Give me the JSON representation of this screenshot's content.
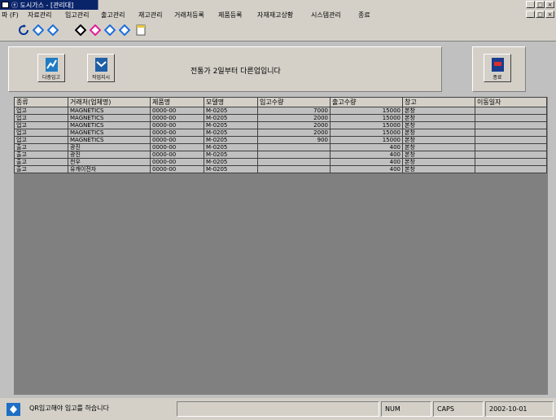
{
  "titlebar": {
    "title": "ⓔ 도시가스 - [관리대]",
    "buttons": [
      "_",
      "□",
      "×"
    ]
  },
  "menubar": {
    "items": [
      "파 (F)",
      "자료관리",
      "입고관리",
      "출고관리",
      "재고관리",
      "거래처등록",
      "제품등록",
      "자재재고상황",
      "시스템관리",
      "종료"
    ],
    "mdi_buttons": [
      "_",
      "□",
      "×"
    ]
  },
  "toolbar": {
    "icons": [
      "refresh-icon",
      "diamond-blue-icon",
      "diamond-blue-icon",
      "diamond-black-icon",
      "diamond-pink-icon",
      "diamond-blue-icon",
      "diamond-blue-icon",
      "document-icon"
    ]
  },
  "panel": {
    "button1_label": "다중입고",
    "button2_label": "작업지시",
    "message": "전통가 2일부터 다른업입니다",
    "close_label": "종료"
  },
  "grid": {
    "columns": [
      "종류",
      "거래처(업체명)",
      "제품명",
      "모델명",
      "입고수량",
      "출고수량",
      "창고",
      "이동일자"
    ],
    "rows": [
      [
        "업고",
        "MAGNETICS",
        "0000-00",
        "M-0205",
        "7000",
        "15000",
        "본창",
        ""
      ],
      [
        "업고",
        "MAGNETICS",
        "0000-00",
        "M-0205",
        "2000",
        "15000",
        "본창",
        ""
      ],
      [
        "업고",
        "MAGNETICS",
        "0000-00",
        "M-0205",
        "2000",
        "15000",
        "본창",
        ""
      ],
      [
        "업고",
        "MAGNETICS",
        "0000-00",
        "M-0205",
        "2000",
        "15000",
        "본창",
        ""
      ],
      [
        "업고",
        "MAGNETICS",
        "0000-00",
        "M-0205",
        "900",
        "15000",
        "본창",
        ""
      ],
      [
        "출고",
        "광진",
        "0000-00",
        "M-0205",
        "",
        "400",
        "본창",
        ""
      ],
      [
        "출고",
        "광진",
        "0000-00",
        "M-0205",
        "",
        "400",
        "본창",
        ""
      ],
      [
        "출고",
        "천우",
        "0000-00",
        "M-0205",
        "",
        "400",
        "본창",
        ""
      ],
      [
        "출고",
        "유캐이전자",
        "0000-00",
        "M-0205",
        "",
        "400",
        "본창",
        ""
      ]
    ]
  },
  "statusbar": {
    "message": "QR입고해야 입고를 하습니다",
    "num": "NUM",
    "caps": "CAPS",
    "date": "2002-10-01"
  },
  "colors": {
    "titlebar": "#0a246a",
    "face": "#d4d0c8",
    "grid_bg": "#808080"
  }
}
